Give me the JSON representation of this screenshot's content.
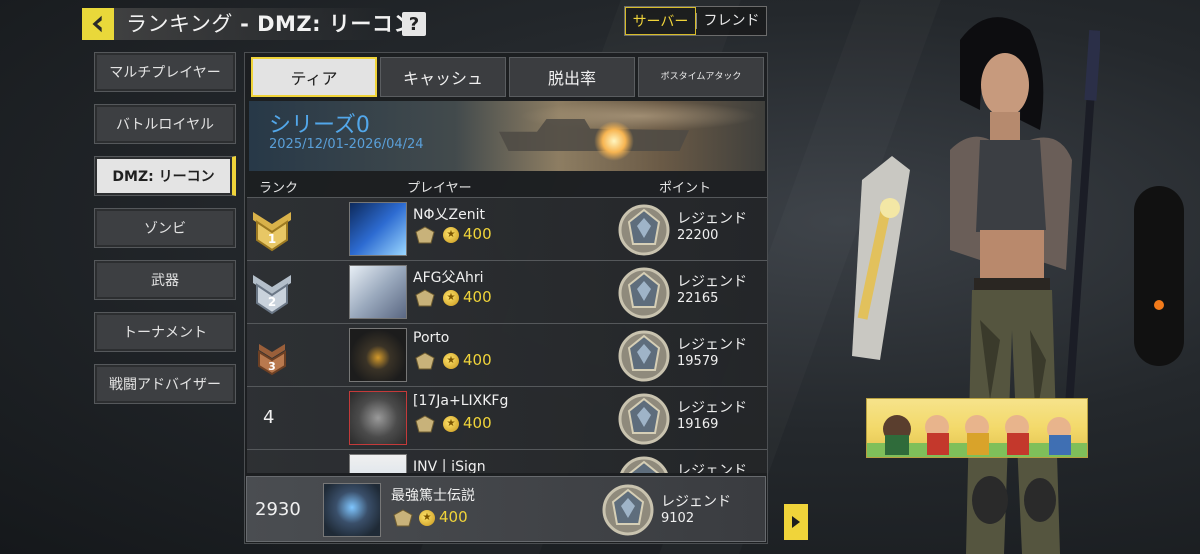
{
  "header": {
    "title": "ランキング",
    "subtitle": "- DMZ: リーコン",
    "help_label": "?",
    "scope_options": [
      "サーバー",
      "フレンド"
    ],
    "scope_selected": "サーバー"
  },
  "sidebar": {
    "items": [
      {
        "label": "マルチプレイヤー",
        "active": false
      },
      {
        "label": "バトルロイヤル",
        "active": false
      },
      {
        "label": "DMZ: リーコン",
        "active": true
      },
      {
        "label": "ゾンビ",
        "active": false
      },
      {
        "label": "武器",
        "active": false
      },
      {
        "label": "トーナメント",
        "active": false
      },
      {
        "label": "戦闘アドバイザー",
        "active": false
      }
    ]
  },
  "tabs": [
    {
      "label": "ティア",
      "active": true
    },
    {
      "label": "キャッシュ",
      "active": false
    },
    {
      "label": "脱出率",
      "active": false
    },
    {
      "label": "ボスタイムアタック",
      "active": false
    }
  ],
  "season": {
    "title": "シリーズ0",
    "dates": "2025/12/01-2026/04/24"
  },
  "columns": {
    "rank": "ランク",
    "player": "プレイヤー",
    "points": "ポイント"
  },
  "rows": [
    {
      "rank": "1",
      "badge": "gold",
      "name": "NΦ乂Zenit",
      "level": "400",
      "tier": "レジェンド",
      "points": "22200"
    },
    {
      "rank": "2",
      "badge": "silver",
      "name": "AFG父Ahri",
      "level": "400",
      "tier": "レジェンド",
      "points": "22165"
    },
    {
      "rank": "3",
      "badge": "bronze",
      "name": "Porto",
      "level": "400",
      "tier": "レジェンド",
      "points": "19579"
    },
    {
      "rank": "4",
      "badge": "none",
      "name": "[17Ja+LIXKFg",
      "level": "400",
      "tier": "レジェンド",
      "points": "19169"
    },
    {
      "rank": "",
      "badge": "none",
      "name": "INV丨iSign",
      "level": "",
      "tier": "レジェンド",
      "points": ""
    }
  ],
  "my_entry": {
    "rank": "2930",
    "name": "最強篤士伝説",
    "level": "400",
    "tier": "レジェンド",
    "points": "9102"
  },
  "colors": {
    "accent": "#f0d43a",
    "season_blue": "#52a7ea",
    "gold": "#d9b24a",
    "silver": "#c9d2dc",
    "bronze": "#b9794e"
  },
  "icons": {
    "back": "chevron-left-icon",
    "help": "question-icon",
    "next": "triangle-right-icon",
    "coin": "coin-icon",
    "tier_emblem": "legend-emblem-icon"
  }
}
